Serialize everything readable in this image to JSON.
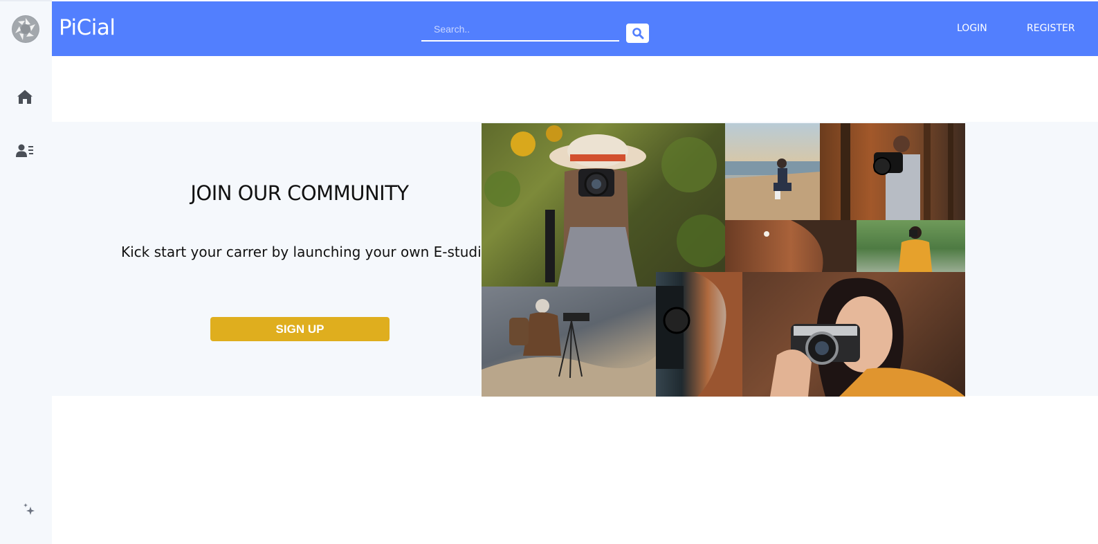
{
  "app": {
    "brand": "PiCial"
  },
  "header": {
    "search_placeholder": "Search..",
    "login_label": "LOGIN",
    "register_label": "REGISTER"
  },
  "sidebar": {
    "icons": [
      "camera-aperture-logo",
      "home-icon",
      "user-list-icon",
      "sparkle-icon"
    ]
  },
  "hero": {
    "title": "JOIN OUR COMMUNITY",
    "subtitle": "Kick start your carrer by launching your own E-studio",
    "signup_label": "SIGN UP"
  },
  "colors": {
    "header_bg": "#527ffe",
    "sidebar_bg": "#f5f8fc",
    "hero_bg": "#f5f8fc",
    "signup_bg": "#dfae1e",
    "icon_color": "#4a4f57"
  }
}
